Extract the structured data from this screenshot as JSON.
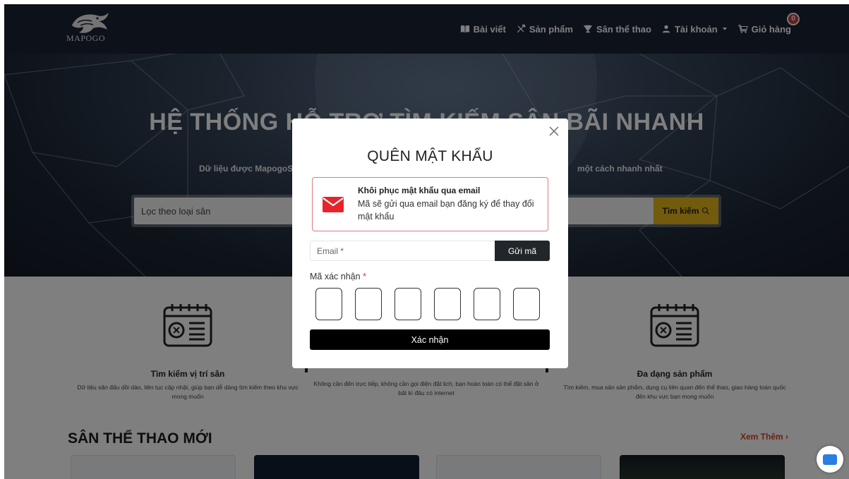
{
  "brand": {
    "logo_text": "MAPOGO"
  },
  "nav": {
    "items": [
      {
        "label": "Bài viết",
        "icon": "book-icon"
      },
      {
        "label": "Sản phẩm",
        "icon": "tools-icon"
      },
      {
        "label": "Sân thể thao",
        "icon": "trophy-icon"
      },
      {
        "label": "Tài khoản",
        "icon": "user-icon"
      },
      {
        "label": "Giỏ hàng",
        "icon": "cart-icon"
      }
    ],
    "cart_count": "0"
  },
  "hero": {
    "title": "HỆ THỐNG HỖ TRỢ TÌM KIẾM SÂN BÃI NHANH",
    "subtitle": "Dữ liệu được MapogoS... một cách nhanh nhất",
    "subtitle_left": "Dữ liệu được MapogoS",
    "subtitle_right": "một cách nhanh nhất",
    "search_placeholder": "Lọc theo loại sân",
    "search_button": "Tìm kiếm"
  },
  "features": [
    {
      "title": "Tìm kiếm vị trí sân",
      "desc": "Dữ liệu sân đấu dồi dào, liên tục cập nhật, giúp bạn dễ dàng tìm kiếm theo khu vực mong muốn"
    },
    {
      "title": "",
      "desc": "Không cần đến trực tiếp, không cần gọi điện đặt lịch, bạn hoàn toàn có thể đặt sân ở bất kì đâu có internet"
    },
    {
      "title": "Đa dạng sản phẩm",
      "desc": "Tìm kiếm, mua sản sản phẩm, dụng cụ liên quan đến thể thao, giao hàng toàn quốc đến khu vực bạn mong muốn"
    }
  ],
  "section": {
    "title": "SÂN THỂ THAO MỚI",
    "see_more": "Xem Thêm ›"
  },
  "modal": {
    "title": "QUÊN MẬT KHẨU",
    "method_title": "Khôi phục mật khẩu qua email",
    "method_desc": "Mã sẽ gửi qua email bạn đăng ký để thay đổi mật khẩu",
    "email_placeholder": "Email *",
    "send_button": "Gửi mã",
    "code_label": "Mã xác nhận",
    "code_required": "*",
    "confirm_button": "Xác nhận"
  },
  "colors": {
    "nav_bg": "#1b2235",
    "search_button": "#e4b719",
    "see_more": "#d2451e",
    "method_border": "#e07a7a",
    "mail_icon": "#e8232a",
    "cart_badge": "#d13a3a"
  }
}
